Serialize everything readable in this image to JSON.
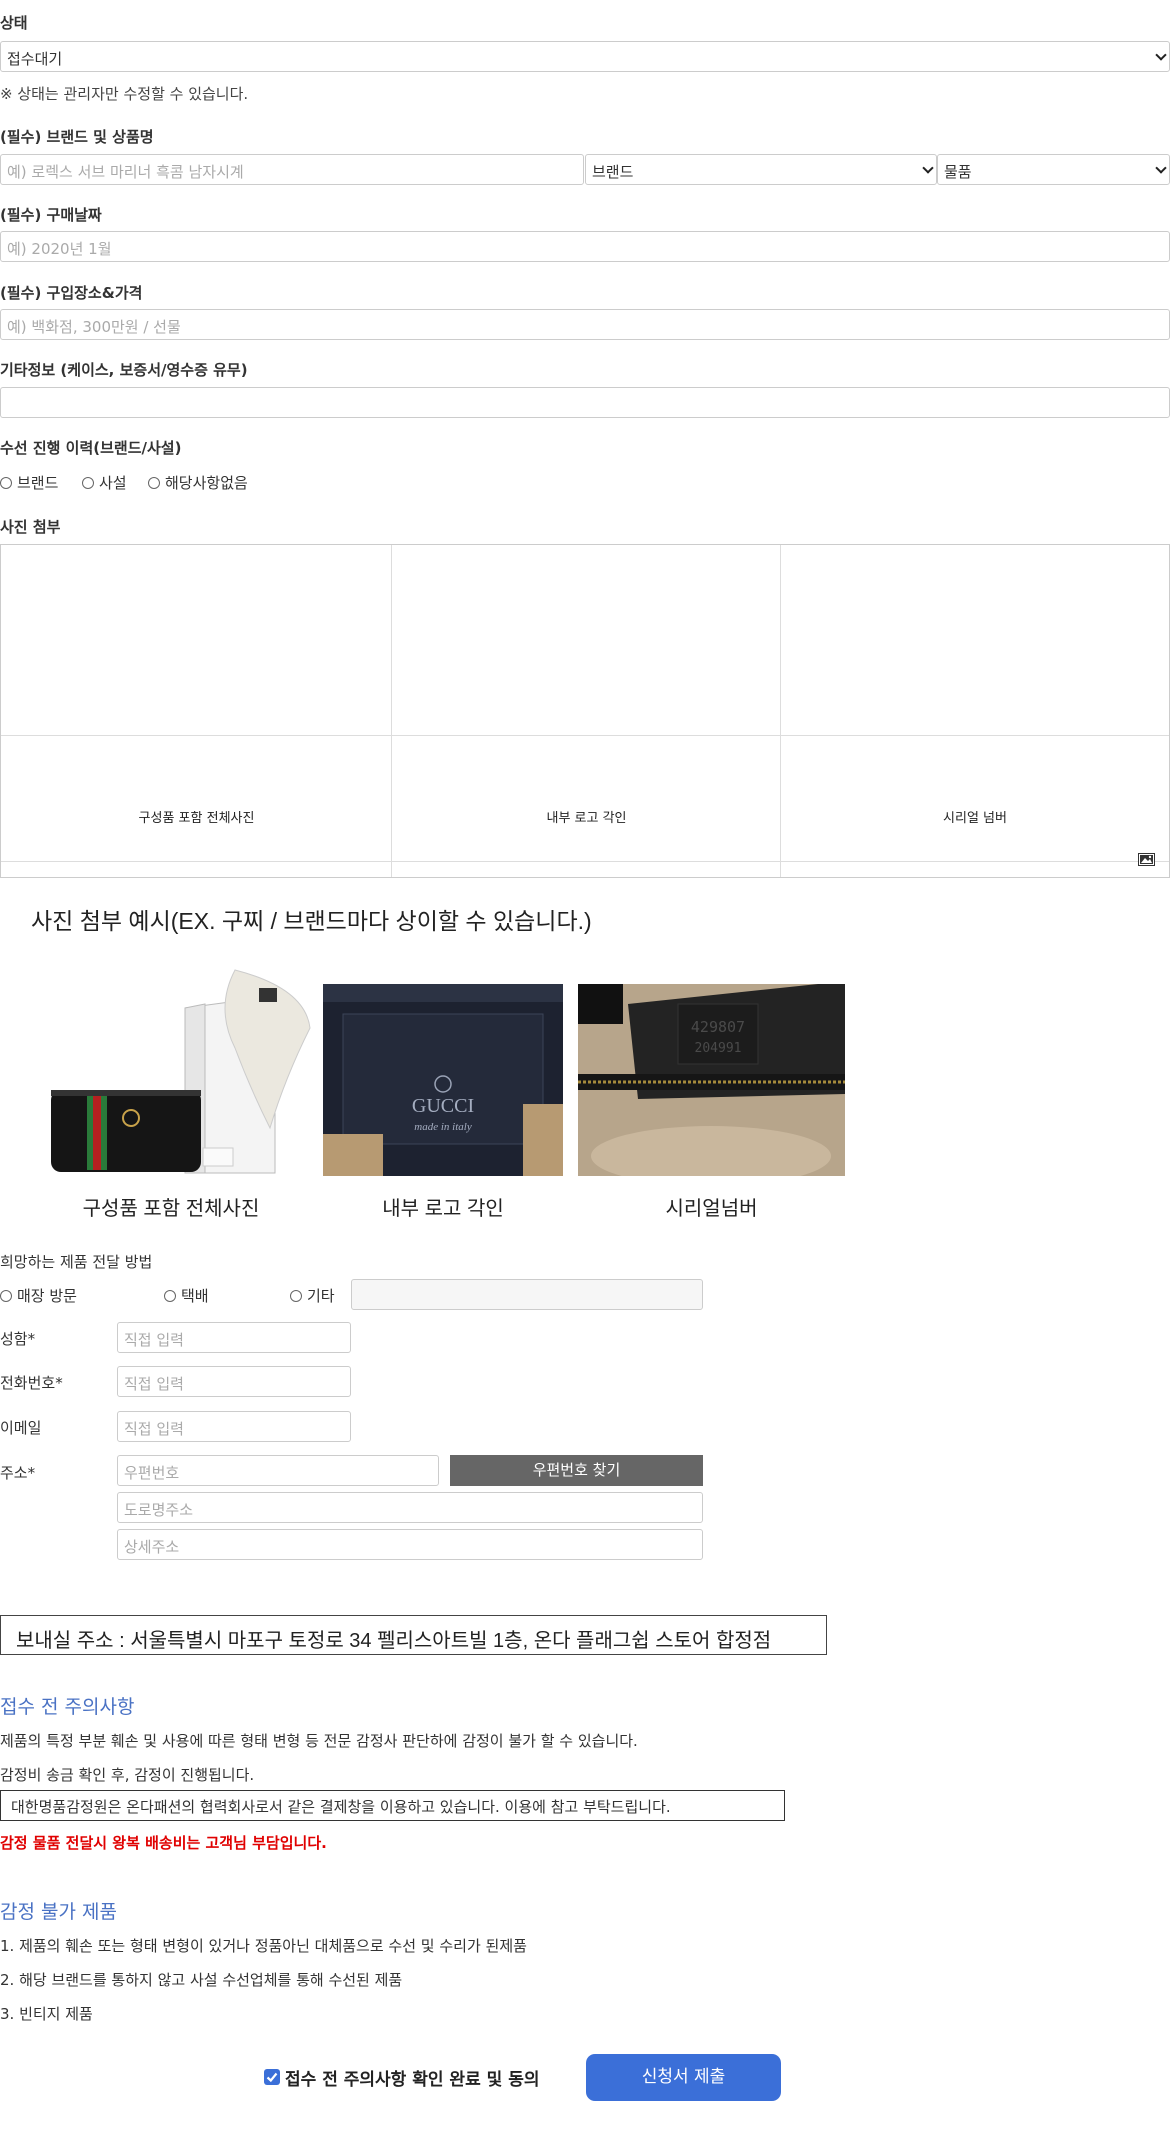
{
  "status": {
    "label": "상태",
    "value": "접수대기",
    "note": "※ 상태는 관리자만 수정할 수 있습니다."
  },
  "brand_product": {
    "label": "(필수) 브랜드 및 상품명",
    "placeholder": "예) 로렉스 서브 마리너 흑콤 남자시계",
    "brand_select": "브랜드",
    "item_select": "물품"
  },
  "purchase_date": {
    "label": "(필수) 구매날짜",
    "placeholder": "예) 2020년 1월"
  },
  "purchase_place": {
    "label": "(필수) 구입장소&가격",
    "placeholder": "예) 백화점, 300만원 / 선물"
  },
  "etc_info": {
    "label": "기타정보 (케이스, 보증서/영수증 유무)",
    "value": ""
  },
  "repair_history": {
    "label": "수선 진행 이력(브랜드/사설)",
    "options": [
      "브랜드",
      "사설",
      "해당사항없음"
    ]
  },
  "photos": {
    "label": "사진 첨부",
    "slots": [
      "구성품 포함 전체사진",
      "내부 로고 각인",
      "시리얼 넘버"
    ],
    "upload_icon": "image-icon"
  },
  "example": {
    "title": "사진 첨부 예시(EX. 구찌 / 브랜드마다 상이할 수 있습니다.)",
    "captions": [
      "구성품 포함 전체사진",
      "내부 로고 각인",
      "시리얼넘버"
    ],
    "logo_text": "GUCCI",
    "logo_sub": "made in italy",
    "serial_line1": "429807",
    "serial_line2": "204991"
  },
  "delivery": {
    "label": "희망하는 제품 전달 방법",
    "options": [
      "매장 방문",
      "택배",
      "기타"
    ],
    "etc_value": ""
  },
  "contact": {
    "name_label": "성함*",
    "phone_label": "전화번호*",
    "email_label": "이메일",
    "address_label": "주소*",
    "placeholder": "직접 입력",
    "zip_placeholder": "우편번호",
    "zip_button": "우편번호 찾기",
    "road_placeholder": "도로명주소",
    "detail_placeholder": "상세주소"
  },
  "ship_address": "보내실 주소 : 서울특별시 마포구 토정로 34 펠리스아트빌 1층, 온다 플래그쉽 스토어 합정점",
  "precautions": {
    "title": "접수 전 주의사항",
    "line1": "제품의 특정 부분 훼손 및 사용에 따른 형태 변형 등 전문 감정사 판단하에 감정이 불가 할 수 있습니다.",
    "line2": "감정비 송금 확인 후, 감정이 진행됩니다.",
    "boxed": "대한명품감정원은 온다패션의 협력회사로서 같은 결제창을 이용하고 있습니다. 이용에 참고 부탁드립니다.",
    "red": "감정 물품 전달시 왕복 배송비는 고객님 부담입니다."
  },
  "not_available": {
    "title": "감정 불가 제품",
    "items": [
      "1. 제품의 훼손 또는 형태 변형이 있거나 정품아닌 대체품으로 수선 및 수리가 된제품",
      "2. 해당 브랜드를 통하지 않고 사설 수선업체를 통해 수선된 제품",
      "3. 빈티지 제품"
    ]
  },
  "agree": {
    "label": "접수 전 주의사항 확인 완료 및 동의",
    "checked": true,
    "submit": "신청서 제출"
  },
  "colors": {
    "accent": "#3b6fd8",
    "heading_blue": "#4a72c4",
    "warning_red": "#e00000",
    "dark_button": "#666666"
  }
}
